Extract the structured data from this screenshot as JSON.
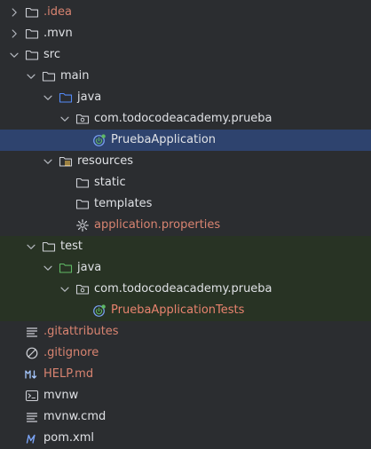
{
  "tree": {
    "items": [
      {
        "label": ".idea",
        "name": "tree-item-idea",
        "icon": "folder-icon",
        "state": "collapsed",
        "tone": "ignored"
      },
      {
        "label": ".mvn",
        "name": "tree-item-mvn",
        "icon": "folder-icon",
        "state": "collapsed",
        "tone": "normal"
      },
      {
        "label": "src",
        "name": "tree-item-src",
        "icon": "folder-icon",
        "state": "expanded",
        "tone": "normal"
      },
      {
        "label": "main",
        "name": "tree-item-main",
        "icon": "folder-icon",
        "state": "expanded",
        "tone": "normal"
      },
      {
        "label": "java",
        "name": "tree-item-main-java",
        "icon": "source-folder-icon",
        "state": "expanded",
        "tone": "normal"
      },
      {
        "label": "com.todocodeacademy.prueba",
        "name": "tree-item-main-package",
        "icon": "package-icon",
        "state": "expanded",
        "tone": "normal"
      },
      {
        "label": "PruebaApplication",
        "name": "tree-item-prueba-application",
        "icon": "spring-boot-class-icon",
        "state": "leaf",
        "tone": "normal",
        "selected": true
      },
      {
        "label": "resources",
        "name": "tree-item-resources",
        "icon": "resources-folder-icon",
        "state": "expanded",
        "tone": "normal"
      },
      {
        "label": "static",
        "name": "tree-item-static",
        "icon": "folder-icon",
        "state": "leaf",
        "tone": "normal"
      },
      {
        "label": "templates",
        "name": "tree-item-templates",
        "icon": "folder-icon",
        "state": "leaf",
        "tone": "normal"
      },
      {
        "label": "application.properties",
        "name": "tree-item-application-properties",
        "icon": "properties-gear-icon",
        "state": "leaf",
        "tone": "props"
      },
      {
        "label": "test",
        "name": "tree-item-test",
        "icon": "folder-icon",
        "state": "expanded",
        "tone": "normal",
        "scope": "test"
      },
      {
        "label": "java",
        "name": "tree-item-test-java",
        "icon": "test-source-folder-icon",
        "state": "expanded",
        "tone": "normal",
        "scope": "test"
      },
      {
        "label": "com.todocodeacademy.prueba",
        "name": "tree-item-test-package",
        "icon": "package-icon",
        "state": "expanded",
        "tone": "normal",
        "scope": "test"
      },
      {
        "label": "PruebaApplicationTests",
        "name": "tree-item-prueba-application-tests",
        "icon": "spring-boot-class-icon",
        "state": "leaf",
        "tone": "testcls",
        "scope": "test"
      },
      {
        "label": ".gitattributes",
        "name": "tree-item-gitattributes",
        "icon": "text-lines-icon",
        "state": "leaf",
        "tone": "ignored"
      },
      {
        "label": ".gitignore",
        "name": "tree-item-gitignore",
        "icon": "ignore-icon",
        "state": "leaf",
        "tone": "ignored"
      },
      {
        "label": "HELP.md",
        "name": "tree-item-help-md",
        "icon": "markdown-icon",
        "state": "leaf",
        "tone": "ignored"
      },
      {
        "label": "mvnw",
        "name": "tree-item-mvnw",
        "icon": "shell-script-icon",
        "state": "leaf",
        "tone": "normal"
      },
      {
        "label": "mvnw.cmd",
        "name": "tree-item-mvnw-cmd",
        "icon": "text-lines-icon",
        "state": "leaf",
        "tone": "normal"
      },
      {
        "label": "pom.xml",
        "name": "tree-item-pom-xml",
        "icon": "maven-icon",
        "state": "leaf",
        "tone": "normal"
      }
    ]
  },
  "colors": {
    "background": "#2b2d30",
    "selection": "#2e436e",
    "test_scope": "#283324",
    "text": "#dfe1e5",
    "ignored_text": "#d98471",
    "folder_stroke": "#ced0d6",
    "source_folder_stroke": "#548af7",
    "test_folder_stroke": "#5fb865",
    "spring_green": "#5fb865"
  }
}
